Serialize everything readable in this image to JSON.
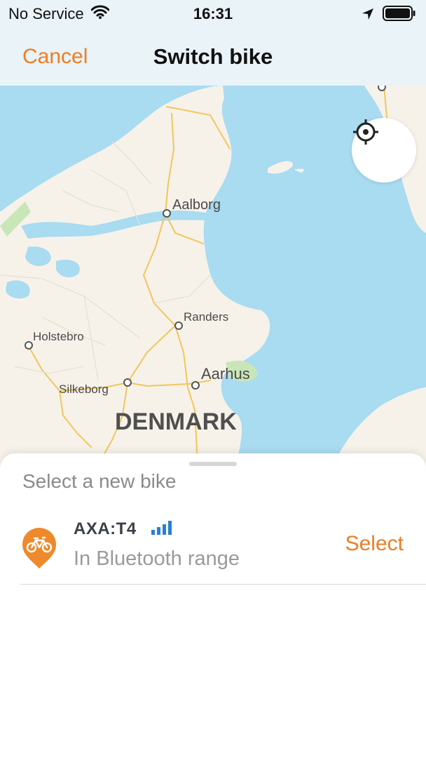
{
  "status_bar": {
    "carrier": "No Service",
    "time": "16:31",
    "icons": [
      "wifi-icon",
      "location-arrow-icon",
      "battery-icon"
    ]
  },
  "nav": {
    "cancel_label": "Cancel",
    "title": "Switch bike"
  },
  "map": {
    "country_label": "DENMARK",
    "cities": [
      {
        "name": "Aalborg"
      },
      {
        "name": "Randers"
      },
      {
        "name": "Holstebro"
      },
      {
        "name": "Aarhus"
      },
      {
        "name": "Silkeborg"
      }
    ],
    "locate_icon": "crosshair-icon"
  },
  "sheet": {
    "heading": "Select a new bike",
    "bikes": [
      {
        "name": "AXA:T4",
        "status": "In Bluetooth range",
        "signal_level": 4,
        "signal_max": 4,
        "action_label": "Select",
        "icon": "bike-pin-icon"
      }
    ]
  },
  "colors": {
    "accent": "#ee7d22",
    "signal": "#2a7fd4",
    "water": "#a9dbf1",
    "land": "#f6f2ea"
  }
}
